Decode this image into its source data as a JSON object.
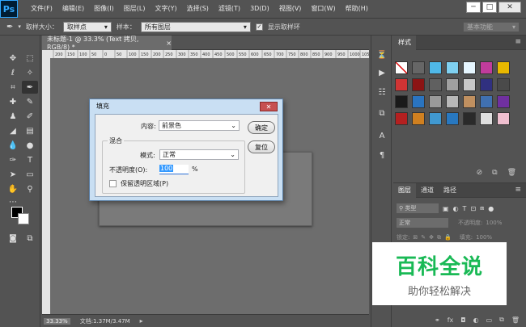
{
  "app": {
    "logo": "Ps"
  },
  "menu": [
    "文件(F)",
    "编辑(E)",
    "图像(I)",
    "图层(L)",
    "文字(Y)",
    "选择(S)",
    "滤镜(T)",
    "3D(D)",
    "视图(V)",
    "窗口(W)",
    "帮助(H)"
  ],
  "window_buttons": {
    "minimize": "─",
    "restore": "□",
    "close": "✕"
  },
  "options_bar": {
    "sample_size_label": "取样大小：",
    "sample_size_value": "取样点",
    "sample_label": "样本：",
    "sample_value": "所有图层",
    "show_ring_label": "显示取样环",
    "show_ring_checked": true,
    "workspace": "基本功能"
  },
  "document": {
    "tab_title": "未标题-1 @ 33.3% (Text 拷贝, RGB/8) *",
    "close": "×",
    "zoom": "33.33%",
    "doc_info": "文档:1.37M/3.47M",
    "ruler_ticks": [
      "200",
      "150",
      "100",
      "50",
      "0",
      "50",
      "100",
      "150",
      "200",
      "250",
      "300",
      "350",
      "400",
      "450",
      "500",
      "550",
      "600",
      "650",
      "700",
      "750",
      "800",
      "850",
      "900",
      "950",
      "1000",
      "1050"
    ]
  },
  "styles_panel": {
    "tab": "样式",
    "swatch_colors": [
      "#ffffff",
      "#666666",
      "#4fb8e8",
      "#7fd0f0",
      "#e6f6ff",
      "#c03c9c",
      "#e8b800",
      "#d03434",
      "#8c1414",
      "#606060",
      "#a0a0a0",
      "#c8c8c8",
      "#303080",
      "#4a4a4a",
      "#1a1a1a",
      "#2a74c0",
      "#9a9a9a",
      "#b8b8b8",
      "#c09060",
      "#4070b0",
      "#7030a0",
      "#b42020",
      "#d08020",
      "#4098d0",
      "#2878c0",
      "#2a2a2a",
      "#e0e0e0",
      "#f0c0d0"
    ]
  },
  "layers_panel": {
    "tabs": [
      "图层",
      "通道",
      "路径"
    ],
    "filter_label": "类型",
    "blend_mode": "正常",
    "opacity_label": "不透明度:",
    "opacity_value": "100%",
    "lock_label": "锁定:",
    "fill_label": "填充:",
    "fill_value": "100%"
  },
  "fill_dialog": {
    "title": "填充",
    "content_label": "内容:",
    "content_value": "前景色",
    "blend_group": "混合",
    "mode_label": "模式:",
    "mode_value": "正常",
    "opacity_label": "不透明度(O):",
    "opacity_value": "100",
    "opacity_unit": "%",
    "preserve_label": "保留透明区域(P)",
    "ok_button": "确定",
    "reset_button": "复位"
  },
  "watermark": {
    "title": "百科全说",
    "subtitle": "助你轻松解决"
  },
  "colors": {
    "fg": "#000000",
    "bg": "#ffffff",
    "watermark_green": "#19b955"
  }
}
